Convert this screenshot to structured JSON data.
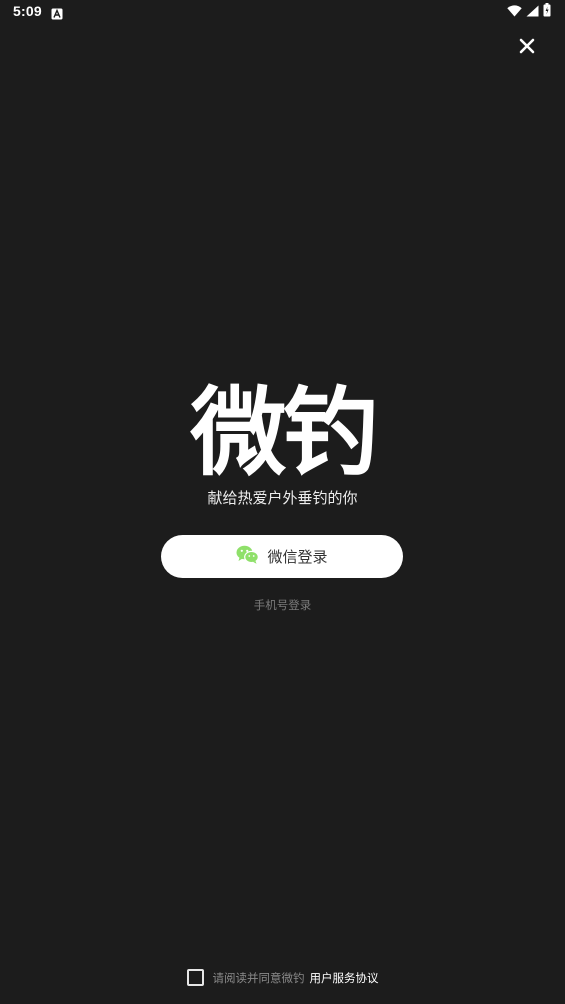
{
  "status_bar": {
    "time": "5:09",
    "app_icon": "a-letter-icon",
    "wifi_icon": "wifi-icon",
    "signal_icon": "cell-signal-icon",
    "battery_icon": "battery-icon"
  },
  "header": {
    "close_icon": "close-icon"
  },
  "brand": {
    "title": "微钓",
    "slogan": "献给热爱户外垂钓的你"
  },
  "login": {
    "wechat_icon": "wechat-icon",
    "wechat_label": "微信登录",
    "wechat_icon_color": "#8fe06a",
    "phone_label": "手机号登录"
  },
  "agreement": {
    "checked": false,
    "text": "请阅读并同意微钓",
    "link_label": "用户服务协议"
  },
  "colors": {
    "background": "#1c1c1c",
    "button": "#ffffff"
  }
}
